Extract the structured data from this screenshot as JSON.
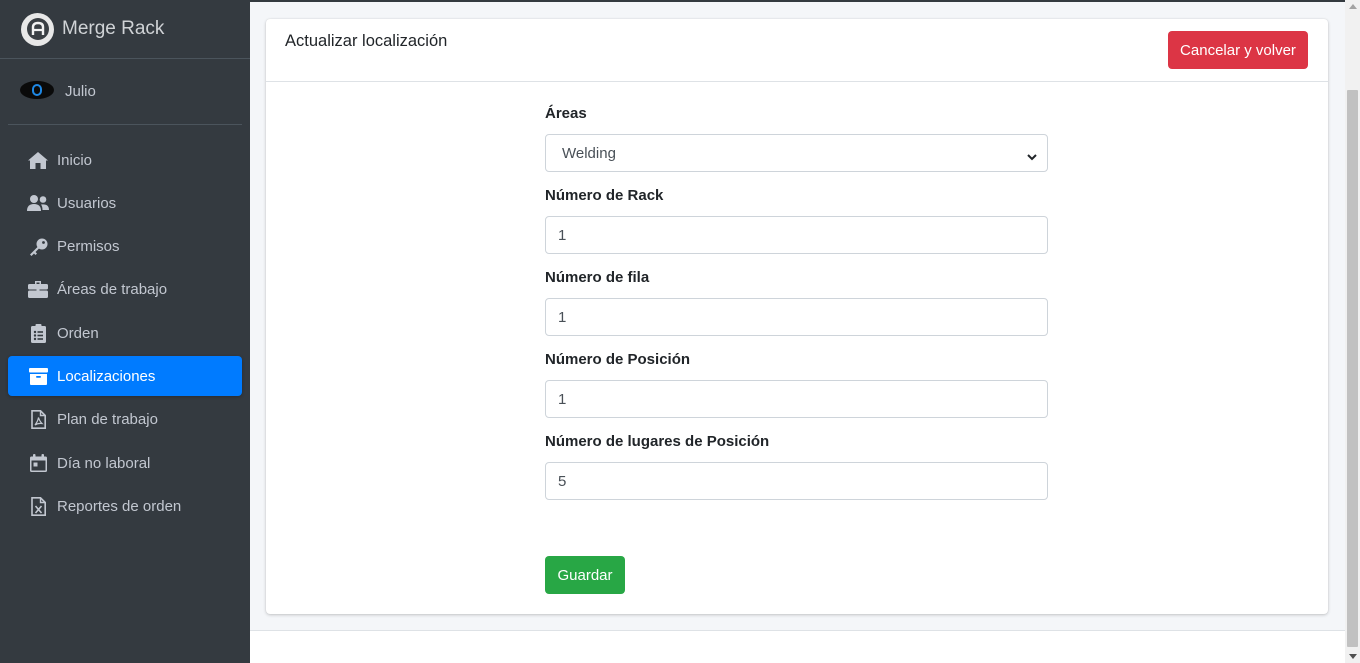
{
  "brand": {
    "name": "Merge Rack",
    "logo_icon": "brand-logo-icon"
  },
  "user": {
    "name": "Julio"
  },
  "sidebar": {
    "items": [
      {
        "label": "Inicio",
        "icon": "home-icon"
      },
      {
        "label": "Usuarios",
        "icon": "users-icon"
      },
      {
        "label": "Permisos",
        "icon": "key-icon"
      },
      {
        "label": "Áreas de trabajo",
        "icon": "briefcase-icon"
      },
      {
        "label": "Orden",
        "icon": "clipboard-list-icon"
      },
      {
        "label": "Localizaciones",
        "icon": "archive-icon",
        "active": true
      },
      {
        "label": "Plan de trabajo",
        "icon": "file-pdf-icon"
      },
      {
        "label": "Día no laboral",
        "icon": "calendar-icon"
      },
      {
        "label": "Reportes de orden",
        "icon": "file-excel-icon"
      }
    ]
  },
  "card": {
    "title": "Actualizar localización",
    "cancel_label": "Cancelar y volver"
  },
  "form": {
    "areas": {
      "label": "Áreas",
      "value": "Welding"
    },
    "rack": {
      "label": "Número de Rack",
      "value": "1"
    },
    "fila": {
      "label": "Número de fila",
      "value": "1"
    },
    "posicion": {
      "label": "Número de Posición",
      "value": "1"
    },
    "lugares": {
      "label": "Número de lugares de Posición",
      "value": "5"
    },
    "save_label": "Guardar"
  },
  "colors": {
    "sidebar_bg": "#343a40",
    "active": "#007bff",
    "danger": "#dc3545",
    "success": "#28a745"
  }
}
